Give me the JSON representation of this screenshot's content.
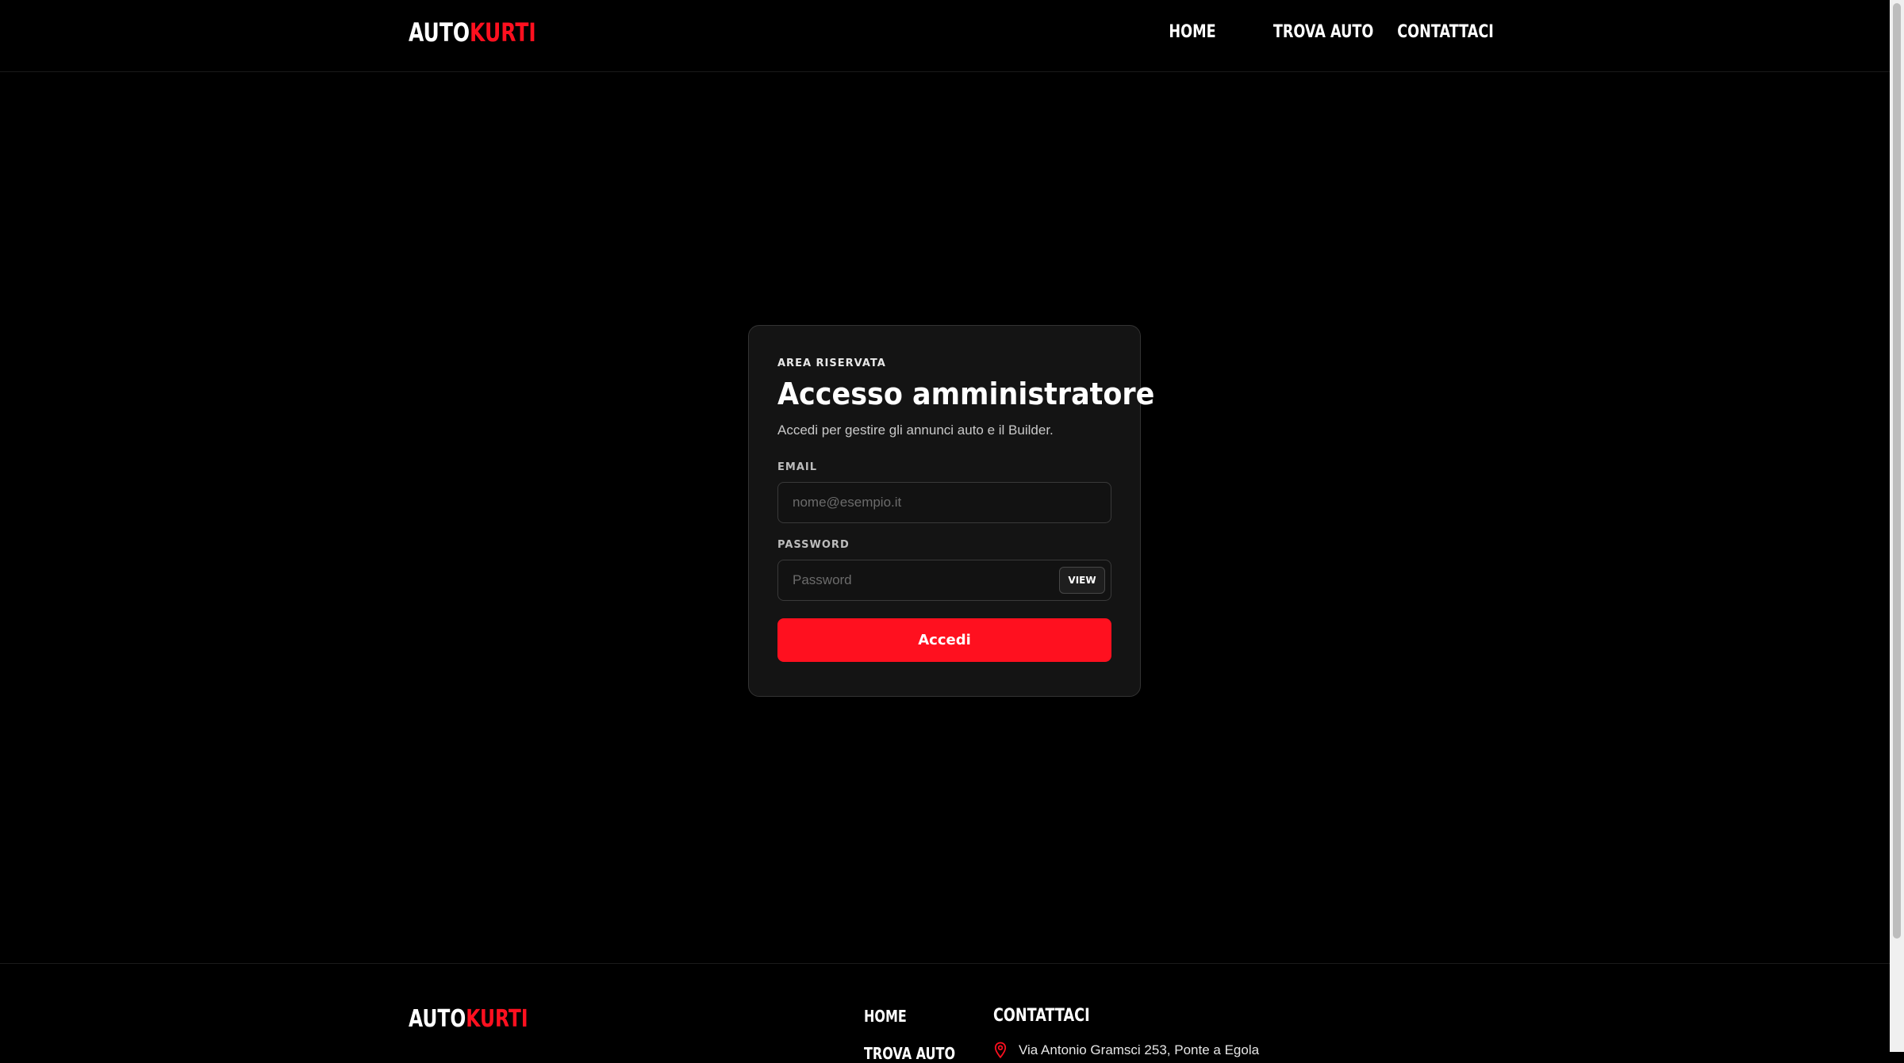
{
  "header": {
    "logo": {
      "part1": "AUTO",
      "part2": "KURTI"
    },
    "nav": [
      {
        "label": "HOME"
      },
      {
        "label": "TROVA AUTO"
      },
      {
        "label": "CONTATTACI"
      }
    ]
  },
  "login": {
    "eyebrow": "AREA RISERVATA",
    "title": "Accesso amministratore",
    "subtitle": "Accedi per gestire gli annunci auto e il Builder.",
    "email": {
      "label": "EMAIL",
      "value": "",
      "placeholder": "nome@esempio.it"
    },
    "password": {
      "label": "PASSWORD",
      "value": "",
      "placeholder": "Password",
      "toggle_label": "VIEW"
    },
    "submit_label": "Accedi"
  },
  "footer": {
    "logo": {
      "part1": "AUTO",
      "part2": "KURTI"
    },
    "nav": [
      {
        "label": "HOME"
      },
      {
        "label": "TROVA AUTO"
      }
    ],
    "contact_heading": "CONTATTACI",
    "address": "Via Antonio Gramsci 253, Ponte a Egola",
    "address_icon": "map-pin-icon"
  },
  "colors": {
    "background": "#000000",
    "accent": "#ff101f",
    "card": "#141414"
  }
}
